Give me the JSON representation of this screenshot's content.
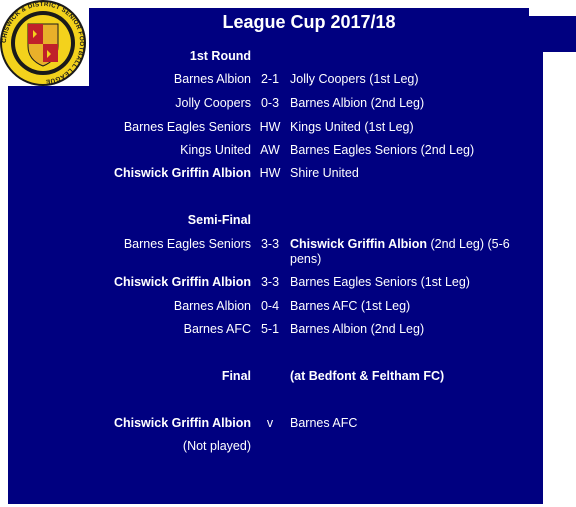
{
  "page": {
    "title": "League Cup 2017/18"
  },
  "logo": {
    "ring_text": "CHISWICK & DISTRICT SENIOR FOOTBALL LEAGUE",
    "colors": {
      "outer": "#f3d21c",
      "inner": "#1a1a1a",
      "shield_red": "#c0202a",
      "shield_gold": "#e8b02a"
    }
  },
  "colors": {
    "panel_bg": "#000080",
    "text": "#ffffff"
  },
  "sections": [
    {
      "heading": "1st Round",
      "matches": [
        {
          "home": "Barnes Albion",
          "score": "2-1",
          "away": "Jolly Coopers (1st Leg)",
          "home_bold": false,
          "away_bold": false
        },
        {
          "home": "Jolly Coopers",
          "score": "0-3",
          "away": "Barnes Albion (2nd Leg)",
          "home_bold": false,
          "away_bold": false
        },
        {
          "home": "Barnes Eagles Seniors",
          "score": "HW",
          "away": "Kings United (1st Leg)",
          "home_bold": false,
          "away_bold": false
        },
        {
          "home": "Kings United",
          "score": "AW",
          "away": "Barnes Eagles Seniors (2nd Leg)",
          "home_bold": false,
          "away_bold": false
        },
        {
          "home": "Chiswick Griffin Albion",
          "score": "HW",
          "away": "Shire United",
          "home_bold": true,
          "away_bold": false
        }
      ]
    },
    {
      "heading": "Semi-Final",
      "matches": [
        {
          "home": "Barnes Eagles Seniors",
          "score": "3-3",
          "away_bold_part": "Chiswick Griffin Albion",
          "away": " (2nd Leg) (5-6 pens)",
          "home_bold": false
        },
        {
          "home": "Chiswick Griffin Albion",
          "score": "3-3",
          "away": "Barnes Eagles Seniors (1st Leg)",
          "home_bold": true,
          "away_bold": false
        },
        {
          "home": "Barnes Albion",
          "score": "0-4",
          "away": "Barnes AFC (1st Leg)",
          "home_bold": false,
          "away_bold": false
        },
        {
          "home": "Barnes AFC",
          "score": "5-1",
          "away": "Barnes Albion (2nd Leg)",
          "home_bold": false,
          "away_bold": false
        }
      ]
    },
    {
      "heading": "Final",
      "venue": "(at Bedfont & Feltham FC)",
      "matches": [
        {
          "home": "Chiswick Griffin Albion",
          "score": "v",
          "away": "Barnes AFC",
          "home_bold": true,
          "away_bold": false
        }
      ],
      "note": "(Not played)"
    }
  ]
}
